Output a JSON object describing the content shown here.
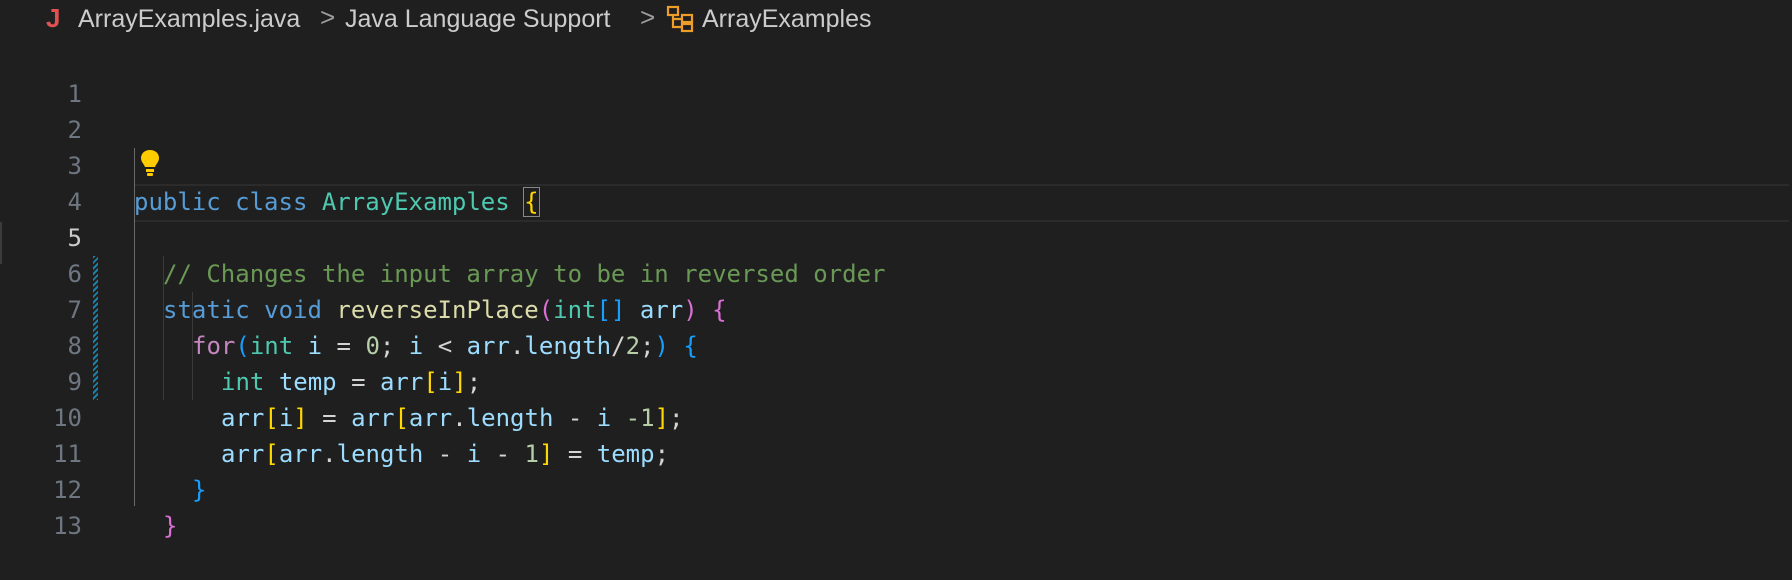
{
  "breadcrumb": {
    "file_icon_glyph": "J",
    "file": "ArrayExamples.java",
    "separator": ">",
    "package": "Java Language Support",
    "class": "ArrayExamples"
  },
  "colors": {
    "background": "#1f1f1f",
    "keyword": "#569cd6",
    "control": "#c586c0",
    "type": "#4ec9b0",
    "function": "#dcdcaa",
    "variable": "#9cdcfe",
    "number": "#b5cea8",
    "comment": "#6a9955",
    "java_icon": "#e05252",
    "lightbulb": "#ffcc00"
  },
  "editor": {
    "active_line": 5,
    "line_numbers": [
      "1",
      "2",
      "3",
      "4",
      "5",
      "6",
      "7",
      "8",
      "9",
      "10",
      "11",
      "12",
      "13"
    ],
    "tokens": {
      "public": "public",
      "class": "class",
      "class_name": "ArrayExamples",
      "open_brace": "{",
      "close_brace": "}",
      "comment": "// Changes the input array to be in reversed order",
      "static": "static",
      "void": "void",
      "method": "reverseInPlace",
      "lparen": "(",
      "rparen": ")",
      "int": "int",
      "brackets": "[]",
      "lbracket": "[",
      "rbracket": "]",
      "arr": "arr",
      "for": "for",
      "i": "i",
      "eq": "=",
      "zero": "0",
      "semi": ";",
      "lt": "<",
      "dot": ".",
      "length": "length",
      "div": "/",
      "two": "2",
      "temp": "temp",
      "minus": "-",
      "one": "1",
      "minus_one_tight": "-1"
    }
  }
}
